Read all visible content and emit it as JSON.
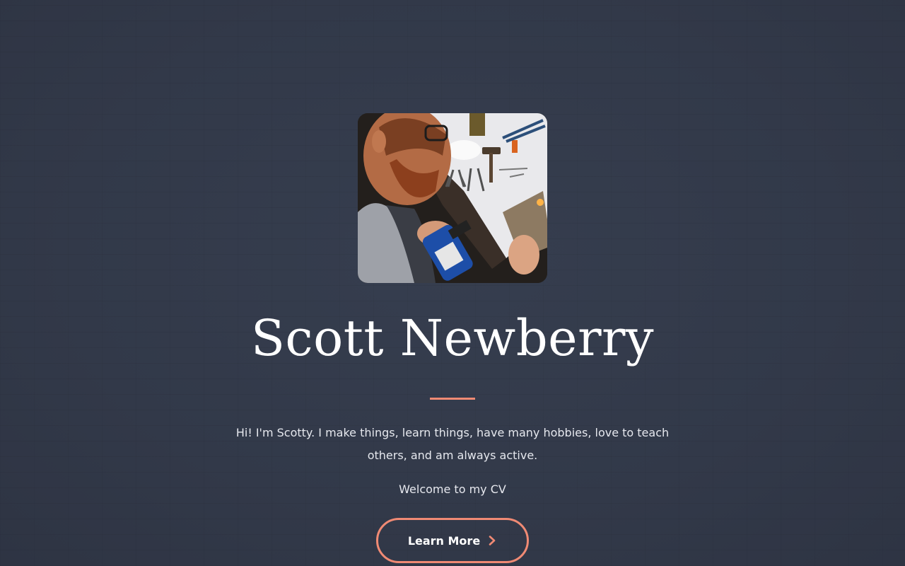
{
  "hero": {
    "name": "Scott Newberry",
    "intro": "Hi! I'm Scotty. I make things, learn things, have many hobbies, love to teach others, and am always active.",
    "welcome": "Welcome to my CV",
    "cta_label": "Learn More",
    "cta_icon": "chevron-right-icon",
    "portrait_alt": "Scott Newberry"
  },
  "colors": {
    "background": "#333a4a",
    "accent": "#f08a74",
    "text": "#ffffff"
  }
}
